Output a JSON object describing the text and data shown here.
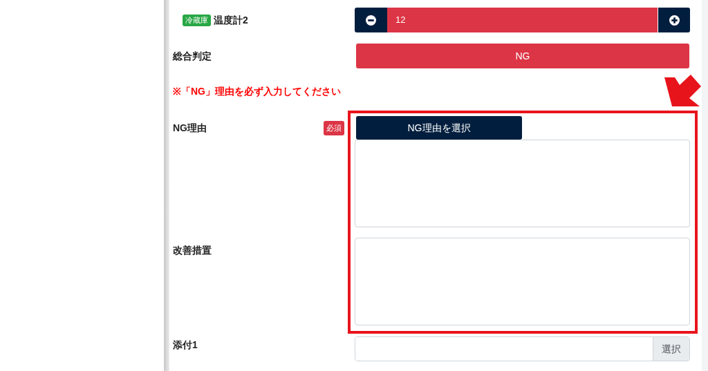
{
  "thermometer": {
    "tag": "冷蔵庫",
    "label": "温度計2",
    "value": "12",
    "alert": true
  },
  "overall": {
    "label": "総合判定",
    "result": "NG",
    "alert": true
  },
  "notice": "※「NG」理由を必ず入力してください",
  "ng_reason": {
    "label": "NG理由",
    "required_badge": "必須",
    "button": "NG理由を選択",
    "highlighted": true
  },
  "improvement": {
    "label": "改善措置"
  },
  "attachment": {
    "label": "添付1",
    "button": "選択"
  }
}
